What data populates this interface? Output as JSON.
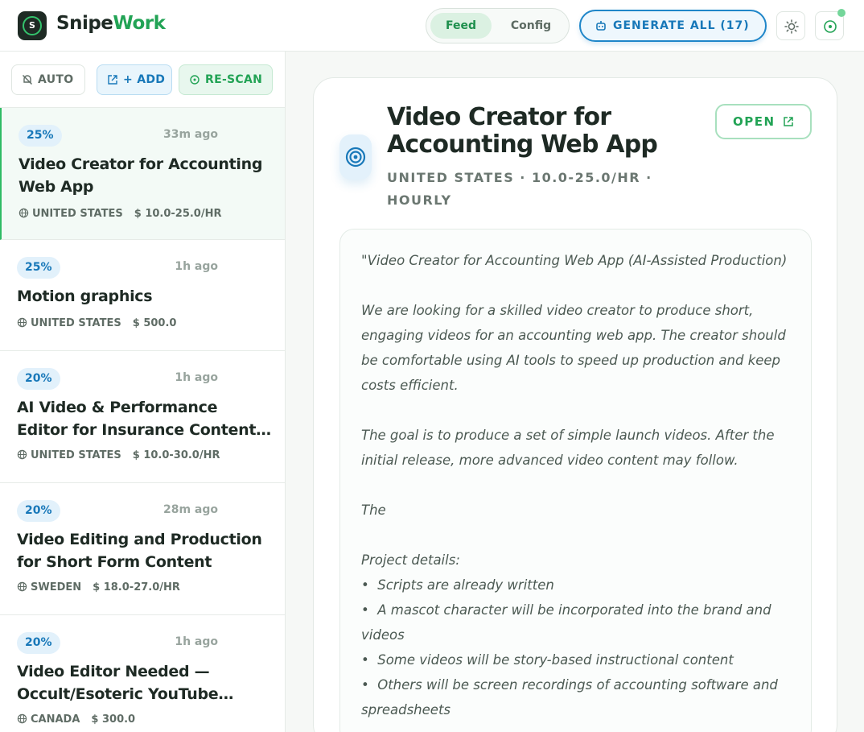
{
  "header": {
    "brand_primary": "Snipe",
    "brand_accent": "Work",
    "logo_letter": "S",
    "tabs": [
      {
        "label": "Feed",
        "active": true
      },
      {
        "label": "Config",
        "active": false
      }
    ],
    "generate_label": "GENERATE ALL (17)",
    "status": "online"
  },
  "sidebar": {
    "toolbar": {
      "auto_label": "AUTO",
      "add_label": "+ ADD",
      "rescan_label": "RE-SCAN"
    },
    "jobs": [
      {
        "match": "25%",
        "time": "33m ago",
        "title": "Video Creator for Accounting Web App",
        "country": "UNITED STATES",
        "price": "10.0-25.0/HR",
        "active": true
      },
      {
        "match": "25%",
        "time": "1h ago",
        "title": "Motion graphics",
        "country": "UNITED STATES",
        "price": "500.0",
        "active": false
      },
      {
        "match": "20%",
        "time": "1h ago",
        "title": "AI Video & Performance Editor for Insurance Content…",
        "country": "UNITED STATES",
        "price": "10.0-30.0/HR",
        "active": false
      },
      {
        "match": "20%",
        "time": "28m ago",
        "title": "Video Editing and Production for Short Form Content",
        "country": "SWEDEN",
        "price": "18.0-27.0/HR",
        "active": false
      },
      {
        "match": "20%",
        "time": "1h ago",
        "title": "Video Editor Needed — Occult/Esoteric YouTube…",
        "country": "CANADA",
        "price": "300.0",
        "active": false
      }
    ]
  },
  "detail": {
    "title": "Video Creator for Accounting Web App",
    "subtitle": "UNITED STATES · 10.0-25.0/HR · HOURLY",
    "open_label": "OPEN",
    "description": "\"Video Creator for Accounting Web App (AI-Assisted Production)\n\nWe are looking for a skilled video creator to produce short, engaging videos for an accounting web app. The creator should be comfortable using AI tools to speed up production and keep costs efficient.\n\nThe goal is to produce a set of simple launch videos. After the initial release, more advanced video content may follow.\n\nThe\n\nProject details:\n•  Scripts are already written\n•  A mascot character will be incorporated into the brand and videos\n•  Some videos will be story-based instructional content\n•  Others will be screen recordings of accounting software and spreadsheets"
  },
  "colors": {
    "brand_green": "#22a355",
    "accent_blue": "#1878b9",
    "dark": "#1e2a24"
  }
}
